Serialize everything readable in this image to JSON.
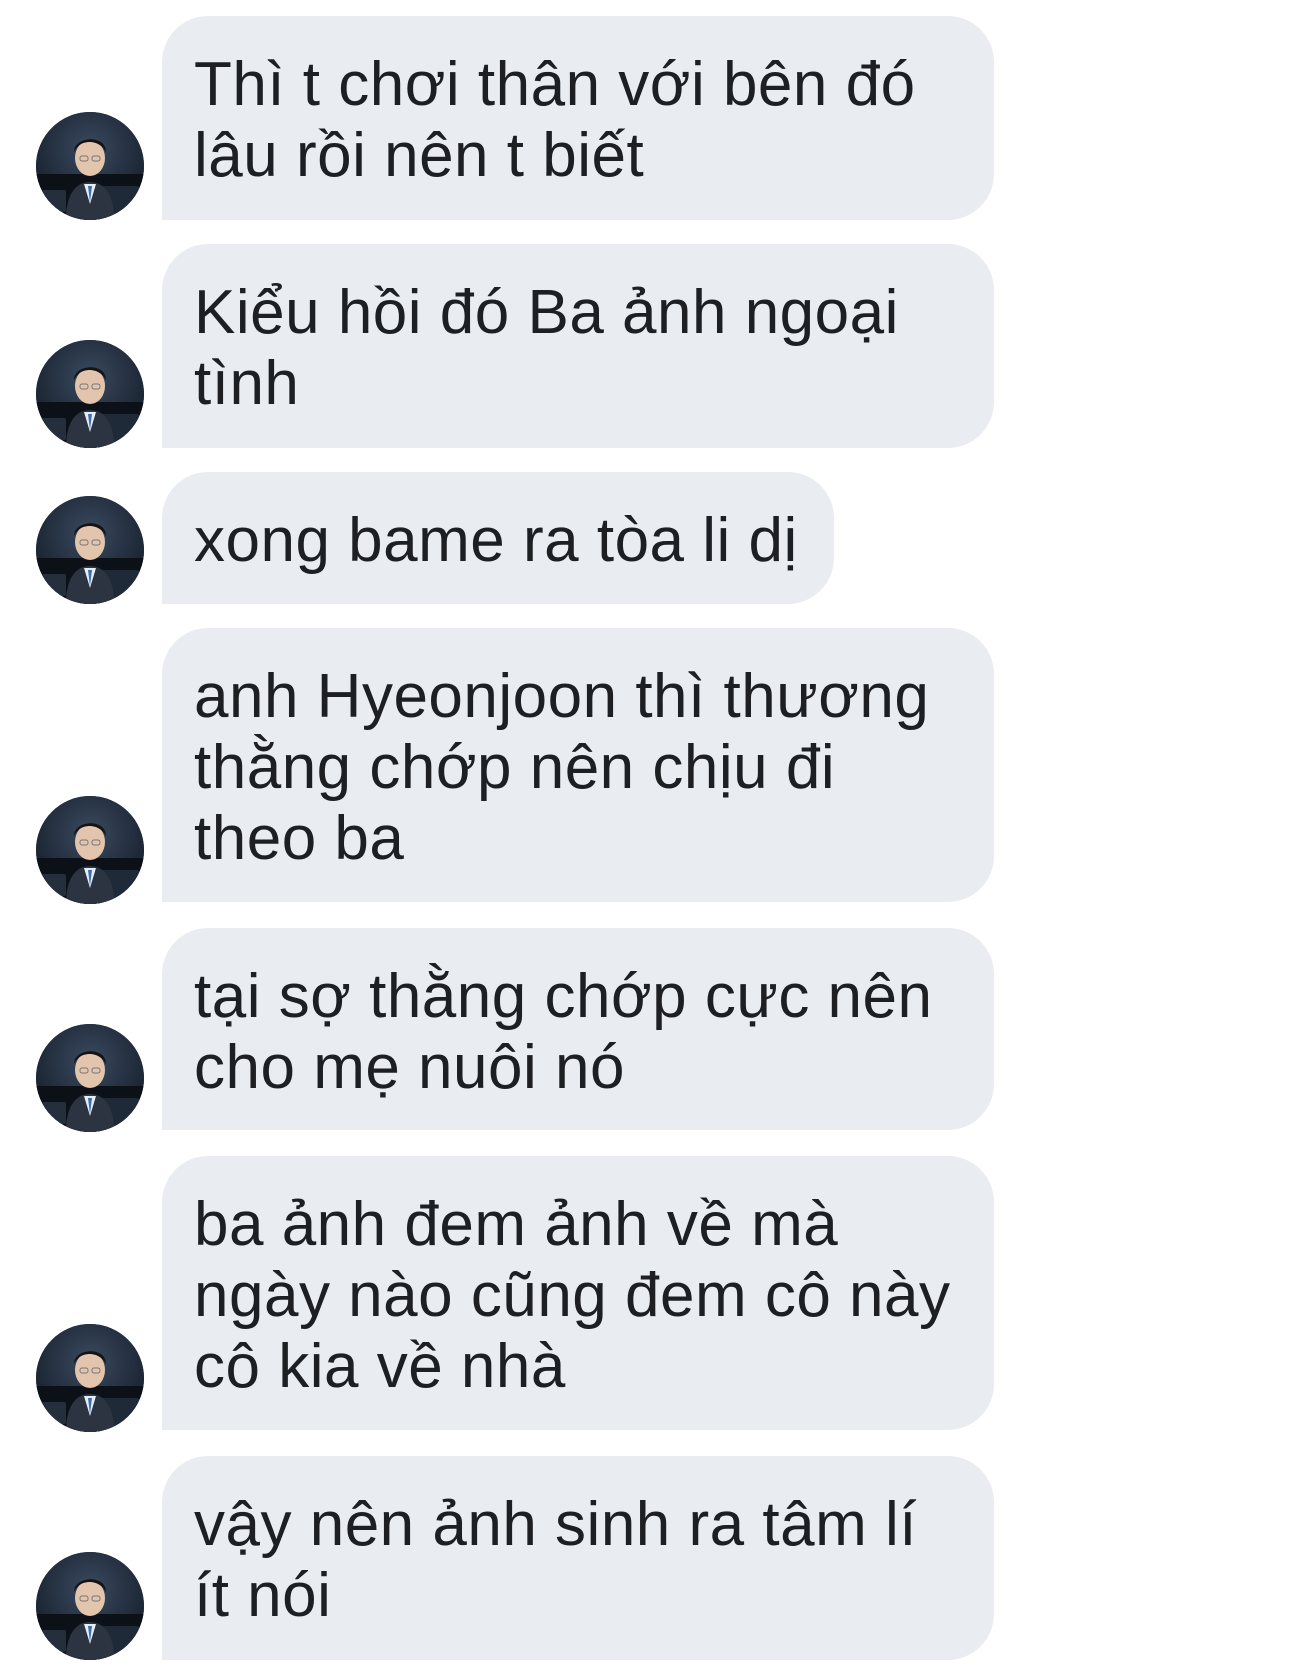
{
  "conversation": {
    "messages": [
      {
        "lines": [
          "Thì t chơi thân với bên đó",
          "lâu rồi nên t biết"
        ]
      },
      {
        "lines": [
          "Kiểu hồi đó Ba ảnh ngoại",
          "tình"
        ]
      },
      {
        "lines": [
          "xong bame ra tòa li dị"
        ]
      },
      {
        "lines": [
          "anh Hyeonjoon thì thương",
          "thằng chớp nên chịu đi",
          "theo ba"
        ]
      },
      {
        "lines": [
          "tại sợ thằng chớp cực nên",
          "cho mẹ nuôi nó"
        ]
      },
      {
        "lines": [
          "ba ảnh đem ảnh về mà",
          "ngày nào cũng đem cô này",
          "cô kia về nhà"
        ]
      },
      {
        "lines": [
          "vậy nên ảnh sinh ra tâm lí",
          "ít nói"
        ]
      }
    ]
  },
  "colors": {
    "bubble_background": "#e9edf2",
    "text": "#1d1f22",
    "page_background": "#ffffff"
  },
  "icons": {
    "avatar": "user-profile-photo"
  }
}
